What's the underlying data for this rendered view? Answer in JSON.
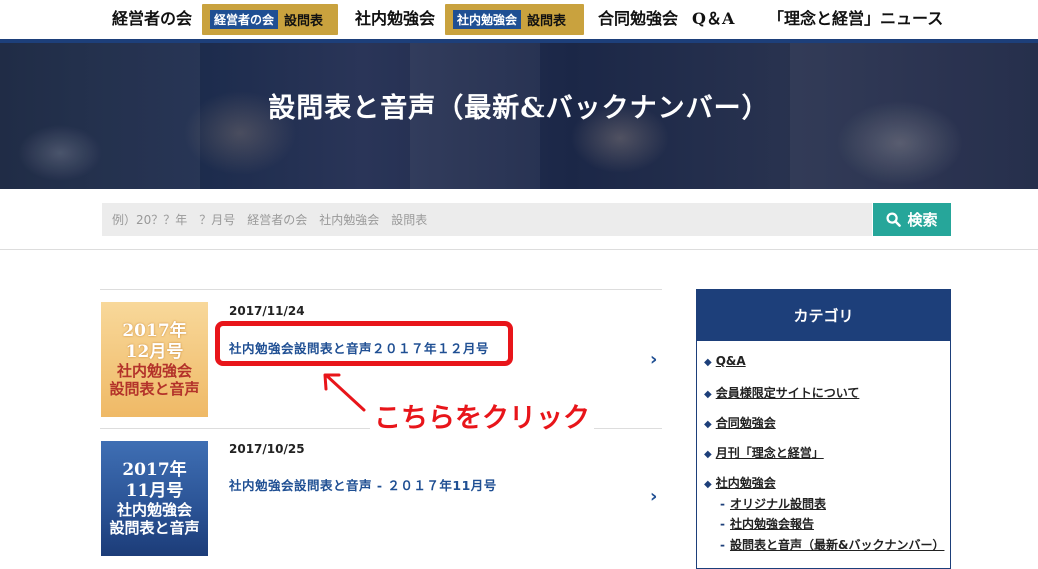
{
  "nav": {
    "items": [
      "経営者の会",
      "社内勉強会",
      "合同勉強会",
      "Q＆A",
      "「理念と経営」ニュース"
    ],
    "gold1": {
      "tag": "経営者の会",
      "label": "設問表"
    },
    "gold2": {
      "tag": "社内勉強会",
      "label": "設問表"
    }
  },
  "hero": {
    "title": "設問表と音声（最新&バックナンバー）"
  },
  "search": {
    "placeholder": "例）20？？年　？月号　経営者の会　社内勉強会　設問表",
    "button": "検索"
  },
  "posts": [
    {
      "date": "2017/11/24",
      "title": "社内勉強会設問表と音声２０１７年１２月号",
      "thumb": {
        "year": "2017年",
        "month": "12月号",
        "line1": "社内勉強会",
        "line2": "設問表と音声"
      }
    },
    {
      "date": "2017/10/25",
      "title": "社内勉強会設問表と音声 - ２０１７年11月号",
      "thumb": {
        "year": "2017年",
        "month": "11月号",
        "line1": "社内勉強会",
        "line2": "設問表と音声"
      }
    }
  ],
  "annotation": {
    "text": "こちらをクリック",
    "color": "#e8151a"
  },
  "sidebar": {
    "title": "カテゴリ",
    "items": [
      "Q&A",
      "会員様限定サイトについて",
      "合同勉強会",
      "月刊「理念と経営」",
      "社内勉強会"
    ],
    "subitems": [
      "オリジナル設問表",
      "社内勉強会報告",
      "設問表と音声（最新&バックナンバー）"
    ]
  },
  "colors": {
    "navy": "#1d3f7a",
    "gold": "#c9a23e",
    "teal": "#26a69a",
    "link": "#1f4f93"
  }
}
